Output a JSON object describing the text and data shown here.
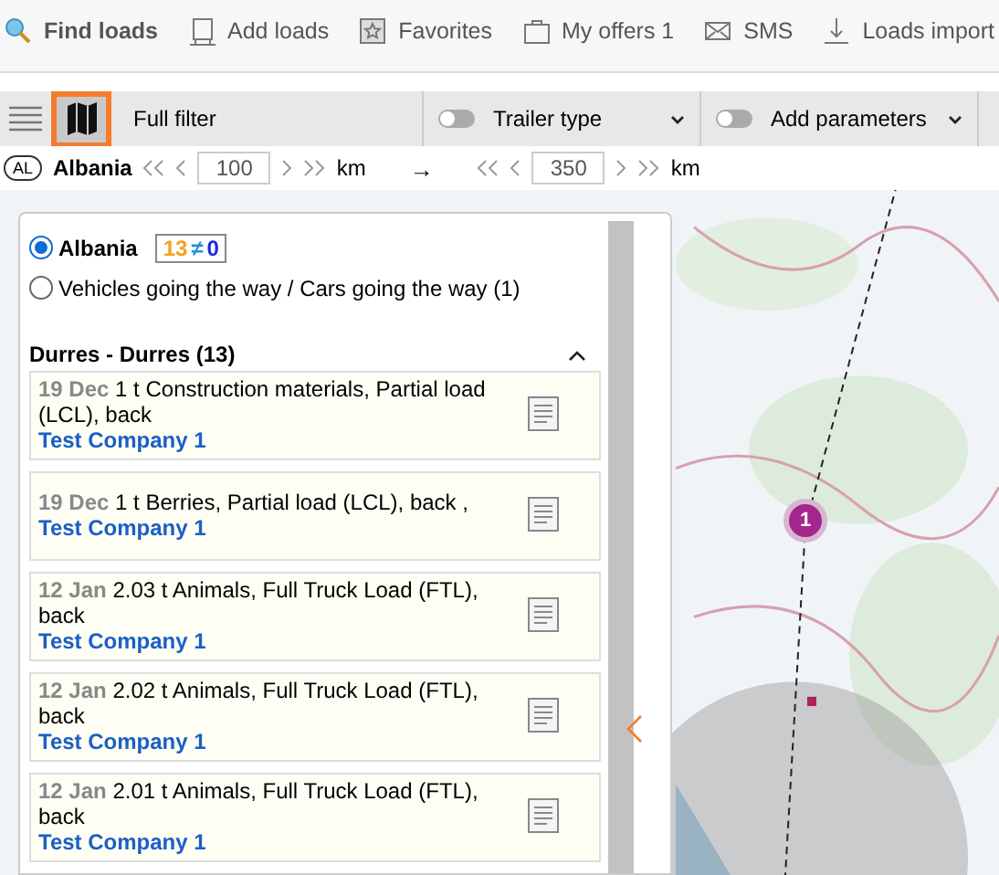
{
  "nav": [
    {
      "label": "Find loads",
      "kind": "search",
      "selected": true
    },
    {
      "label": "Add loads",
      "kind": "board",
      "selected": false
    },
    {
      "label": "Favorites",
      "kind": "star",
      "selected": false
    },
    {
      "label": "My offers 1",
      "kind": "case",
      "selected": false
    },
    {
      "label": "SMS",
      "kind": "mail",
      "selected": false
    },
    {
      "label": "Loads import",
      "kind": "download",
      "selected": false
    }
  ],
  "toolbar": {
    "map_selected": true,
    "filter": "Full filter",
    "toggles": [
      {
        "label": "Trailer type",
        "on": false
      },
      {
        "label": "Add parameters",
        "on": false
      }
    ]
  },
  "route": {
    "country_code": "AL",
    "country": "Albania",
    "from_km": "100",
    "to_km": "350",
    "from_unit": "km",
    "to_unit": "km",
    "arrow": "→"
  },
  "panel": {
    "options": [
      {
        "label": "Albania",
        "selected": true,
        "count_a": "13",
        "sep": "≠",
        "count_b": "0"
      },
      {
        "label": "Vehicles going the way / Cars going the way (1)",
        "selected": false
      }
    ],
    "group": {
      "title": "Durres - Durres (13)",
      "expanded": true
    },
    "loads": [
      {
        "date": "19 Dec",
        "text": "1 t Construction materials, Partial load (LCL), back",
        "company": "Test Company 1"
      },
      {
        "date": "19 Dec",
        "text": "1 t Berries, Partial load (LCL), back ,",
        "company": "Test Company 1"
      },
      {
        "date": "12 Jan",
        "text": "2.03 t Animals, Full Truck Load (FTL), back",
        "company": "Test Company 1"
      },
      {
        "date": "12 Jan",
        "text": "2.02 t Animals, Full Truck Load (FTL), back",
        "company": "Test Company 1"
      },
      {
        "date": "12 Jan",
        "text": "2.01 t Animals, Full Truck Load (FTL), back",
        "company": "Test Company 1"
      }
    ]
  },
  "map": {
    "kind": "picture",
    "marker": "1"
  }
}
